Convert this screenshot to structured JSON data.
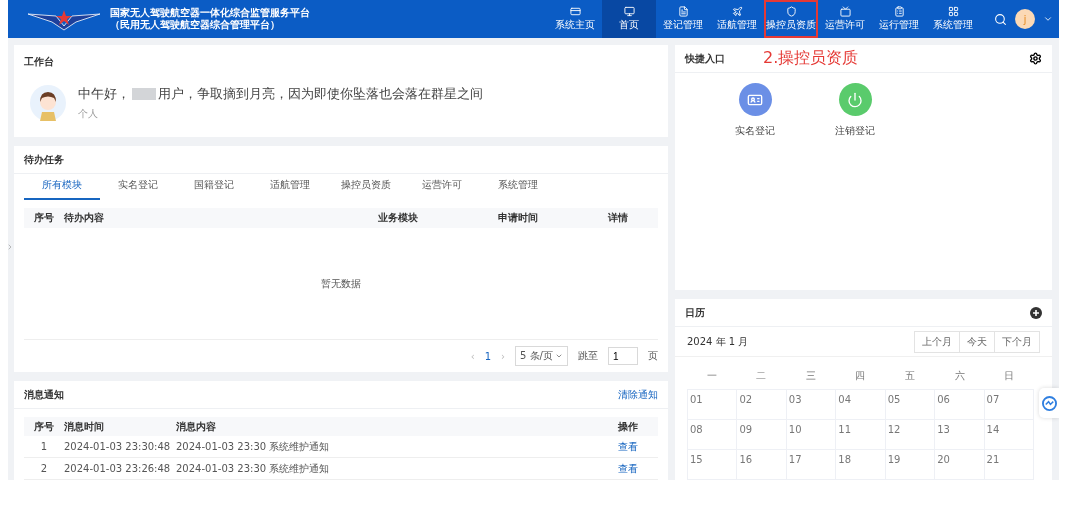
{
  "header": {
    "title": "国家无人驾驶航空器一体化综合监管服务平台",
    "subtitle": "（民用无人驾驶航空器综合管理平台）",
    "nav": [
      {
        "label": "系统主页",
        "selected": false,
        "highlighted": false
      },
      {
        "label": "首页",
        "selected": true,
        "highlighted": false
      },
      {
        "label": "登记管理",
        "selected": false,
        "highlighted": false
      },
      {
        "label": "适航管理",
        "selected": false,
        "highlighted": false
      },
      {
        "label": "操控员资质",
        "selected": false,
        "highlighted": true
      },
      {
        "label": "运营许可",
        "selected": false,
        "highlighted": false
      },
      {
        "label": "运行管理",
        "selected": false,
        "highlighted": false
      },
      {
        "label": "系统管理",
        "selected": false,
        "highlighted": false
      }
    ],
    "avatar": "j"
  },
  "workbench": {
    "title": "工作台",
    "greeting_before": "中午好，",
    "greeting_after": "用户，争取摘到月亮，因为即使你坠落也会落在群星之间",
    "role": "个人"
  },
  "tasks": {
    "title": "待办任务",
    "tabs": [
      {
        "label": "所有模块",
        "selected": true
      },
      {
        "label": "实名登记",
        "selected": false
      },
      {
        "label": "国籍登记",
        "selected": false
      },
      {
        "label": "适航管理",
        "selected": false
      },
      {
        "label": "操控员资质",
        "selected": false
      },
      {
        "label": "运营许可",
        "selected": false
      },
      {
        "label": "系统管理",
        "selected": false
      }
    ],
    "columns": [
      "序号",
      "待办内容",
      "业务模块",
      "申请时间",
      "详情"
    ],
    "empty": "暂无数据",
    "pagination": {
      "prev": "‹",
      "page": "1",
      "next": "›",
      "size": "5 条/页",
      "jump_label": "跳至",
      "jump_value": "1",
      "page_unit": "页"
    }
  },
  "messages": {
    "title": "消息通知",
    "clear": "清除通知",
    "columns": [
      "序号",
      "消息时间",
      "消息内容",
      "操作"
    ],
    "rows": [
      {
        "index": "1",
        "time": "2024-01-03 23:30:48",
        "content": "2024-01-03 23:30 系统维护通知",
        "action": "查看"
      },
      {
        "index": "2",
        "time": "2024-01-03 23:26:48",
        "content": "2024-01-03 23:30 系统维护通知",
        "action": "查看"
      }
    ]
  },
  "quick": {
    "title": "快捷入口",
    "annotation": "2.操控员资质",
    "items": [
      {
        "label": "实名登记",
        "kind": "id",
        "color": "#6b8fe6"
      },
      {
        "label": "注销登记",
        "kind": "power",
        "color": "#5acb6c"
      }
    ]
  },
  "calendar": {
    "title": "日历",
    "month": "2024 年 1 月",
    "buttons": [
      "上个月",
      "今天",
      "下个月"
    ],
    "weekdays": [
      "一",
      "二",
      "三",
      "四",
      "五",
      "六",
      "日"
    ],
    "weeks": [
      [
        "01",
        "02",
        "03",
        "04",
        "05",
        "06",
        "07"
      ],
      [
        "08",
        "09",
        "10",
        "11",
        "12",
        "13",
        "14"
      ],
      [
        "15",
        "16",
        "17",
        "18",
        "19",
        "20",
        "21"
      ]
    ]
  }
}
